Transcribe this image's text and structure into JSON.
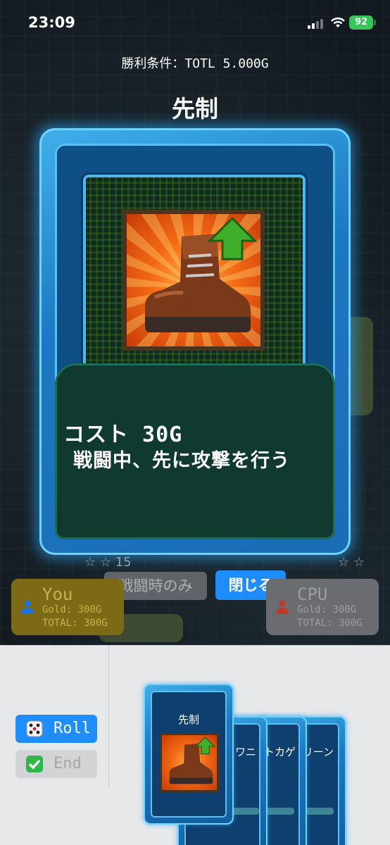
{
  "status_bar": {
    "time": "23:09",
    "battery": "92"
  },
  "win_condition": "勝利条件：TOTL 5.000G",
  "card": {
    "title": "先制",
    "cost": "コスト 30G",
    "description": "戦闘中、先に攻撃を行う",
    "art_icon": "boot-up-arrow-icon"
  },
  "buttons": {
    "battle_only": "戦闘時のみ",
    "close": "閉じる"
  },
  "stars": {
    "left": "☆ ☆ 15",
    "right": "☆ ☆"
  },
  "players": {
    "you": {
      "name": "You",
      "gold": "Gold: 300G",
      "total": "TOTAL: 300G",
      "color": "#c6b24c"
    },
    "cpu": {
      "name": "CPU",
      "gold": "Gold: 300G",
      "total": "TOTAL: 300G",
      "color": "#9c9ea2"
    }
  },
  "tray": {
    "roll_label": "Roll",
    "end_label": "End",
    "hand": [
      {
        "name": "先制"
      },
      {
        "name": "ワニ"
      },
      {
        "name": "トカゲ"
      },
      {
        "name": "リーン"
      }
    ]
  },
  "colors": {
    "accent": "#1e8dff",
    "card_glow": "#3fb0ea"
  }
}
